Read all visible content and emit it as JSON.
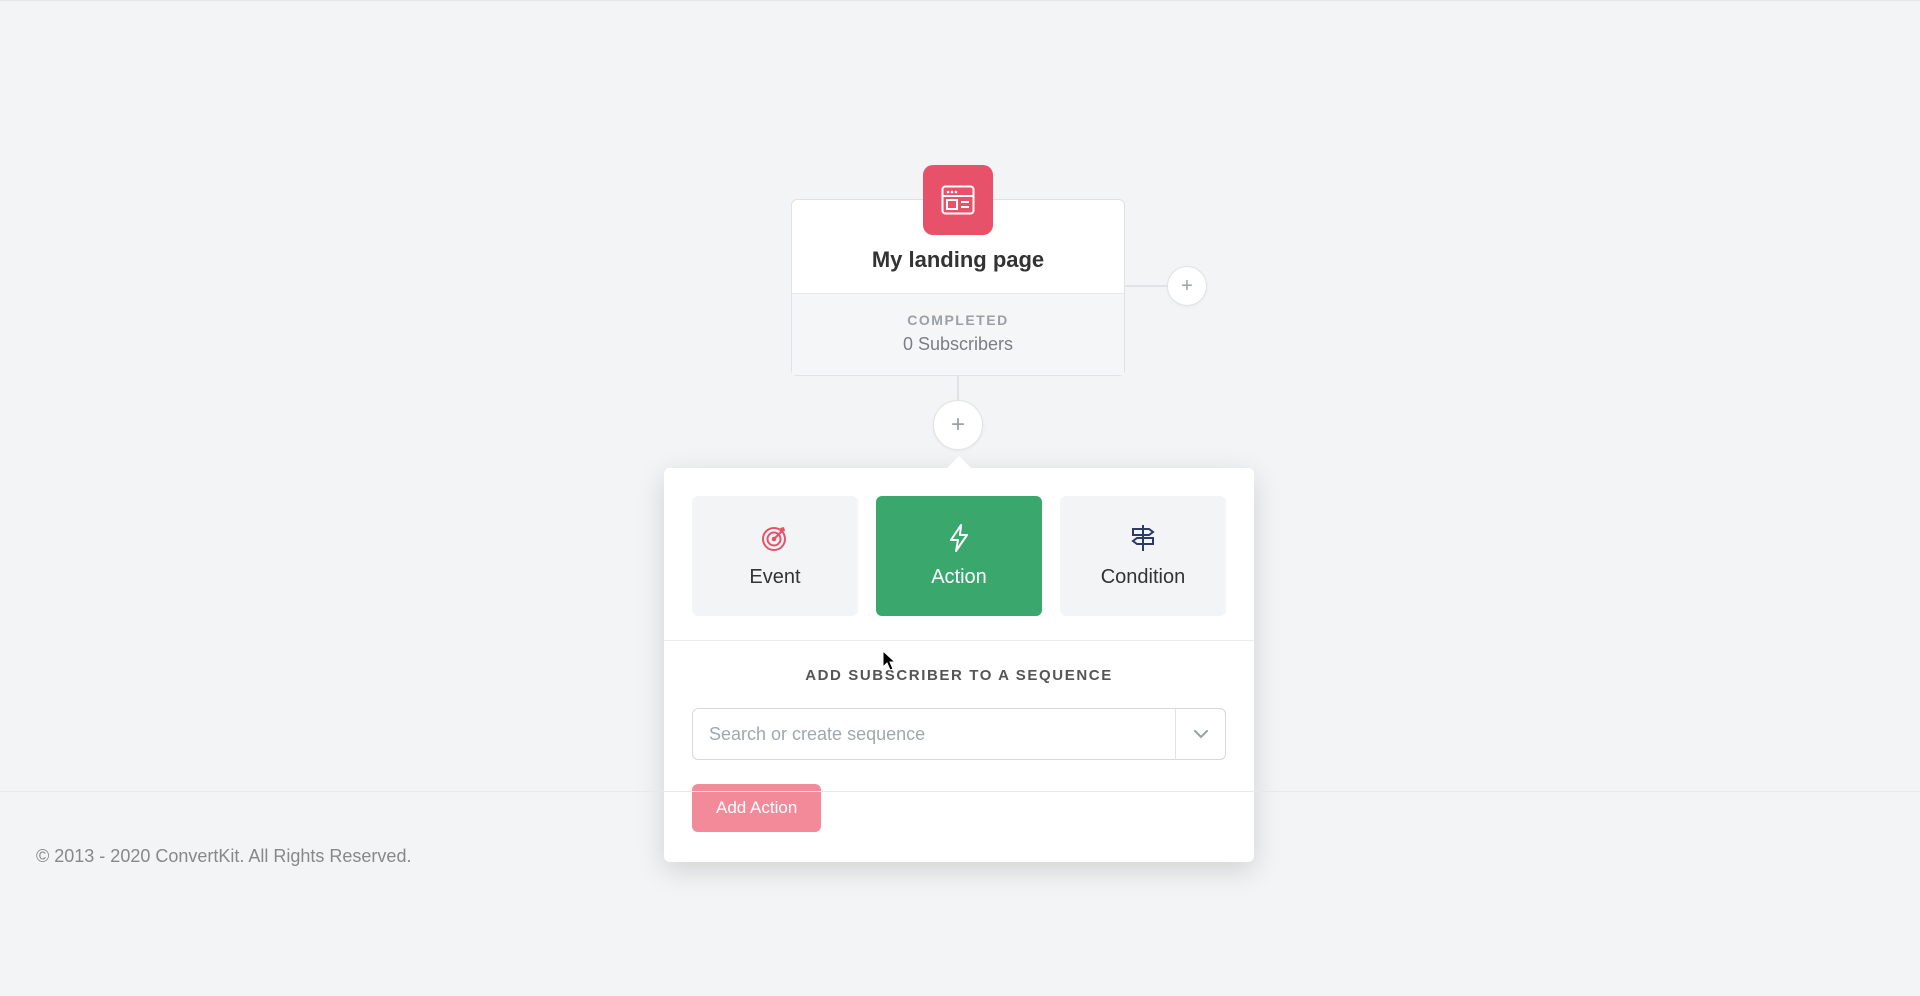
{
  "node": {
    "title": "My landing page",
    "status": "COMPLETED",
    "subscribers": "0 Subscribers",
    "icon": "landing-page-icon"
  },
  "buttons": {
    "add_right": "+",
    "add_below": "+"
  },
  "popover": {
    "tabs": {
      "event": {
        "label": "Event",
        "icon": "target-icon"
      },
      "action": {
        "label": "Action",
        "icon": "bolt-icon"
      },
      "condition": {
        "label": "Condition",
        "icon": "signpost-icon"
      }
    },
    "section_title": "ADD SUBSCRIBER TO A SEQUENCE",
    "sequence_select": {
      "placeholder": "Search or create sequence",
      "value": ""
    },
    "submit_label": "Add Action"
  },
  "footer": "© 2013 - 2020 ConvertKit. All Rights Reserved."
}
